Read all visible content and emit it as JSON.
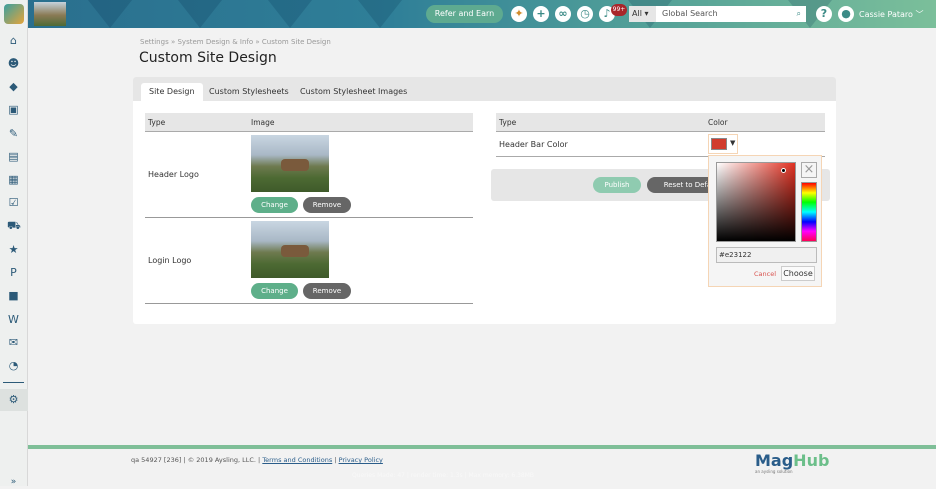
{
  "header": {
    "refer_label": "Refer and Earn",
    "notifications_badge": "99+",
    "search_scope": "All",
    "search_placeholder": "Global Search",
    "user_name": "Cassie Pataro"
  },
  "breadcrumb": [
    "Settings",
    "System Design & Info",
    "Custom Site Design"
  ],
  "breadcrumb_sep": "»",
  "page_title": "Custom Site Design",
  "tabs": [
    {
      "label": "Site Design",
      "active": true
    },
    {
      "label": "Custom Stylesheets"
    },
    {
      "label": "Custom Stylesheet Images"
    }
  ],
  "images_table": {
    "headers": [
      "Type",
      "Image"
    ],
    "rows": [
      {
        "type": "Header Logo"
      },
      {
        "type": "Login Logo"
      }
    ],
    "change_label": "Change",
    "remove_label": "Remove"
  },
  "color_table": {
    "headers": [
      "Type",
      "Color"
    ],
    "rows": [
      {
        "type": "Header Bar Color",
        "color": "#d13b2c"
      }
    ]
  },
  "actions": {
    "publish": "Publish",
    "reset": "Reset to Default"
  },
  "color_picker": {
    "value": "#e23122",
    "cancel": "Cancel",
    "choose": "Choose"
  },
  "footer": {
    "info": "qa 54927 [236] | © 2019 Aysling, LLC. |",
    "terms": "Terms and Conditions",
    "privacy": "Privacy Policy",
    "stats": "Queries Made: 47 | render time: 1.3s | Max memory: 6.38MB",
    "logo_text_a": "Mag",
    "logo_text_b": "Hub",
    "logo_tagline": "an aysling solution"
  },
  "colors": {
    "accent": "#5eaf8a",
    "header_teal": "#2f7f98",
    "sidebar_icon": "#2c5a78",
    "footer_line": "#7fbf98"
  }
}
